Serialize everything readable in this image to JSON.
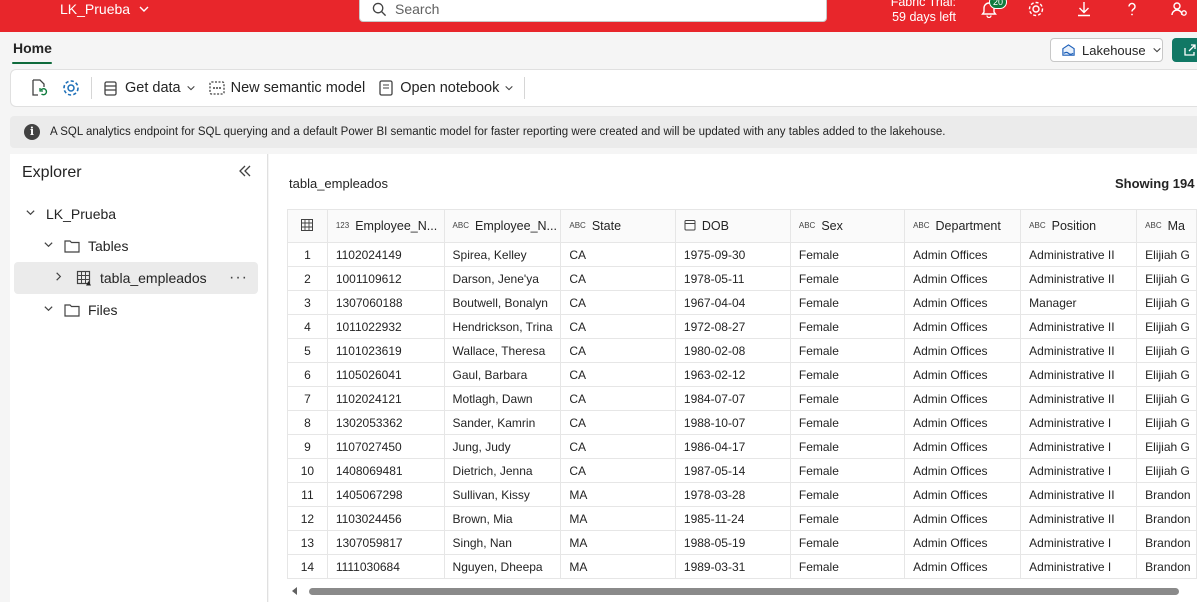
{
  "topbar": {
    "workspace": "LK_Prueba",
    "search_placeholder": "Search",
    "trial_line1": "Fabric Trial:",
    "trial_line2": "59 days left",
    "notification_count": "20"
  },
  "tabs": {
    "home": "Home"
  },
  "item_switcher": {
    "label": "Lakehouse"
  },
  "toolbar": {
    "get_data": "Get data",
    "new_semantic_model": "New semantic model",
    "open_notebook": "Open notebook"
  },
  "banner": {
    "message": "A SQL analytics endpoint for SQL querying and a default Power BI semantic model for faster reporting were created and will be updated with any tables added to the lakehouse."
  },
  "explorer": {
    "title": "Explorer",
    "root": "LK_Prueba",
    "tables_folder": "Tables",
    "table_item": "tabla_empleados",
    "files_folder": "Files"
  },
  "preview": {
    "table_name": "tabla_empleados",
    "showing": "Showing 194",
    "columns": [
      {
        "type": "123",
        "name": "Employee_N..."
      },
      {
        "type": "ABC",
        "name": "Employee_N..."
      },
      {
        "type": "ABC",
        "name": "State"
      },
      {
        "type": "cal",
        "name": "DOB"
      },
      {
        "type": "ABC",
        "name": "Sex"
      },
      {
        "type": "ABC",
        "name": "Department"
      },
      {
        "type": "ABC",
        "name": "Position"
      },
      {
        "type": "ABC",
        "name": "Ma"
      }
    ],
    "rows": [
      [
        "1",
        "1102024149",
        "Spirea, Kelley",
        "CA",
        "1975-09-30",
        "Female",
        "Admin Offices",
        "Administrative II",
        "Elijiah G"
      ],
      [
        "2",
        "1001109612",
        "Darson, Jene'ya",
        "CA",
        "1978-05-11",
        "Female",
        "Admin Offices",
        "Administrative II",
        "Elijiah G"
      ],
      [
        "3",
        "1307060188",
        "Boutwell, Bonalyn",
        "CA",
        "1967-04-04",
        "Female",
        "Admin Offices",
        "Manager",
        "Elijiah G"
      ],
      [
        "4",
        "1011022932",
        "Hendrickson, Trina",
        "CA",
        "1972-08-27",
        "Female",
        "Admin Offices",
        "Administrative II",
        "Elijiah G"
      ],
      [
        "5",
        "1101023619",
        "Wallace, Theresa",
        "CA",
        "1980-02-08",
        "Female",
        "Admin Offices",
        "Administrative II",
        "Elijiah G"
      ],
      [
        "6",
        "1105026041",
        "Gaul, Barbara",
        "CA",
        "1963-02-12",
        "Female",
        "Admin Offices",
        "Administrative II",
        "Elijiah G"
      ],
      [
        "7",
        "1102024121",
        "Motlagh, Dawn",
        "CA",
        "1984-07-07",
        "Female",
        "Admin Offices",
        "Administrative II",
        "Elijiah G"
      ],
      [
        "8",
        "1302053362",
        "Sander, Kamrin",
        "CA",
        "1988-10-07",
        "Female",
        "Admin Offices",
        "Administrative I",
        "Elijiah G"
      ],
      [
        "9",
        "1107027450",
        "Jung, Judy",
        "CA",
        "1986-04-17",
        "Female",
        "Admin Offices",
        "Administrative I",
        "Elijiah G"
      ],
      [
        "10",
        "1408069481",
        "Dietrich, Jenna",
        "CA",
        "1987-05-14",
        "Female",
        "Admin Offices",
        "Administrative I",
        "Elijiah G"
      ],
      [
        "11",
        "1405067298",
        "Sullivan, Kissy",
        "MA",
        "1978-03-28",
        "Female",
        "Admin Offices",
        "Administrative II",
        "Brandon"
      ],
      [
        "12",
        "1103024456",
        "Brown, Mia",
        "MA",
        "1985-11-24",
        "Female",
        "Admin Offices",
        "Administrative II",
        "Brandon"
      ],
      [
        "13",
        "1307059817",
        "Singh, Nan",
        "MA",
        "1988-05-19",
        "Female",
        "Admin Offices",
        "Administrative I",
        "Brandon"
      ],
      [
        "14",
        "1111030684",
        "Nguyen, Dheepa",
        "MA",
        "1989-03-31",
        "Female",
        "Admin Offices",
        "Administrative I",
        "Brandon"
      ]
    ]
  }
}
